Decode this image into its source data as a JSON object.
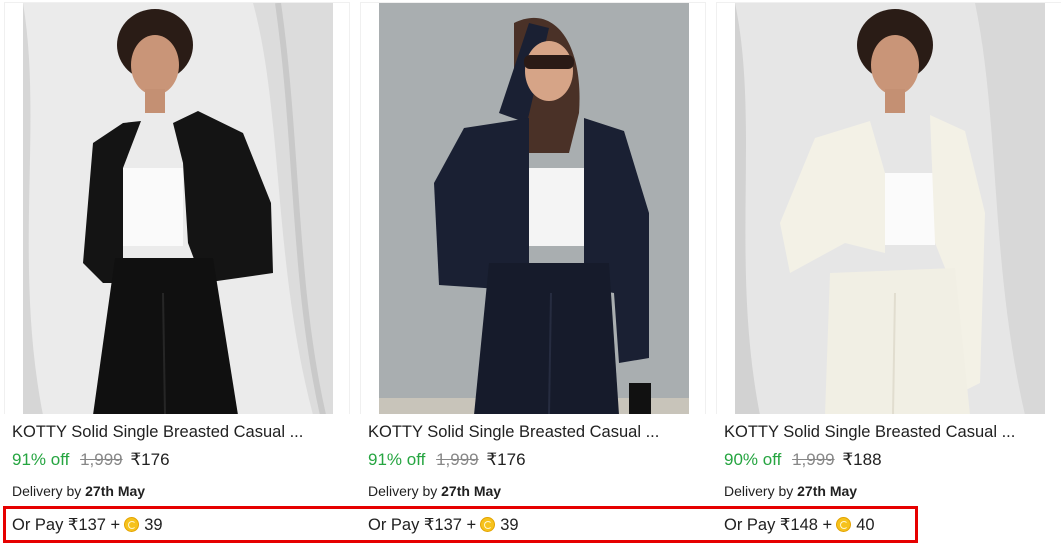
{
  "products": [
    {
      "title": "KOTTY Solid Single Breasted Casual ...",
      "discount": "91% off",
      "mrp": "1,999",
      "price": "₹176",
      "delivery_prefix": "Delivery by",
      "delivery_date": "27th May",
      "pay_text": "Or Pay ₹137 +",
      "coins": "39",
      "outfit_color": "#141414",
      "bg_color": "#e9e9e9"
    },
    {
      "title": "KOTTY Solid Single Breasted Casual ...",
      "discount": "91% off",
      "mrp": "1,999",
      "price": "₹176",
      "delivery_prefix": "Delivery by",
      "delivery_date": "27th May",
      "pay_text": "Or Pay ₹137 +",
      "coins": "39",
      "outfit_color": "#1a2033",
      "bg_color": "#a7acae"
    },
    {
      "title": "KOTTY Solid Single Breasted Casual ...",
      "discount": "90% off",
      "mrp": "1,999",
      "price": "₹188",
      "delivery_prefix": "Delivery by",
      "delivery_date": "27th May",
      "pay_text": "Or Pay ₹148 +",
      "coins": "40",
      "outfit_color": "#f3f1e6",
      "bg_color": "#e4e4e4"
    }
  ],
  "colors": {
    "discount_green": "#26a541",
    "highlight_red": "#e60000",
    "coin_gold": "#f6c21c"
  }
}
